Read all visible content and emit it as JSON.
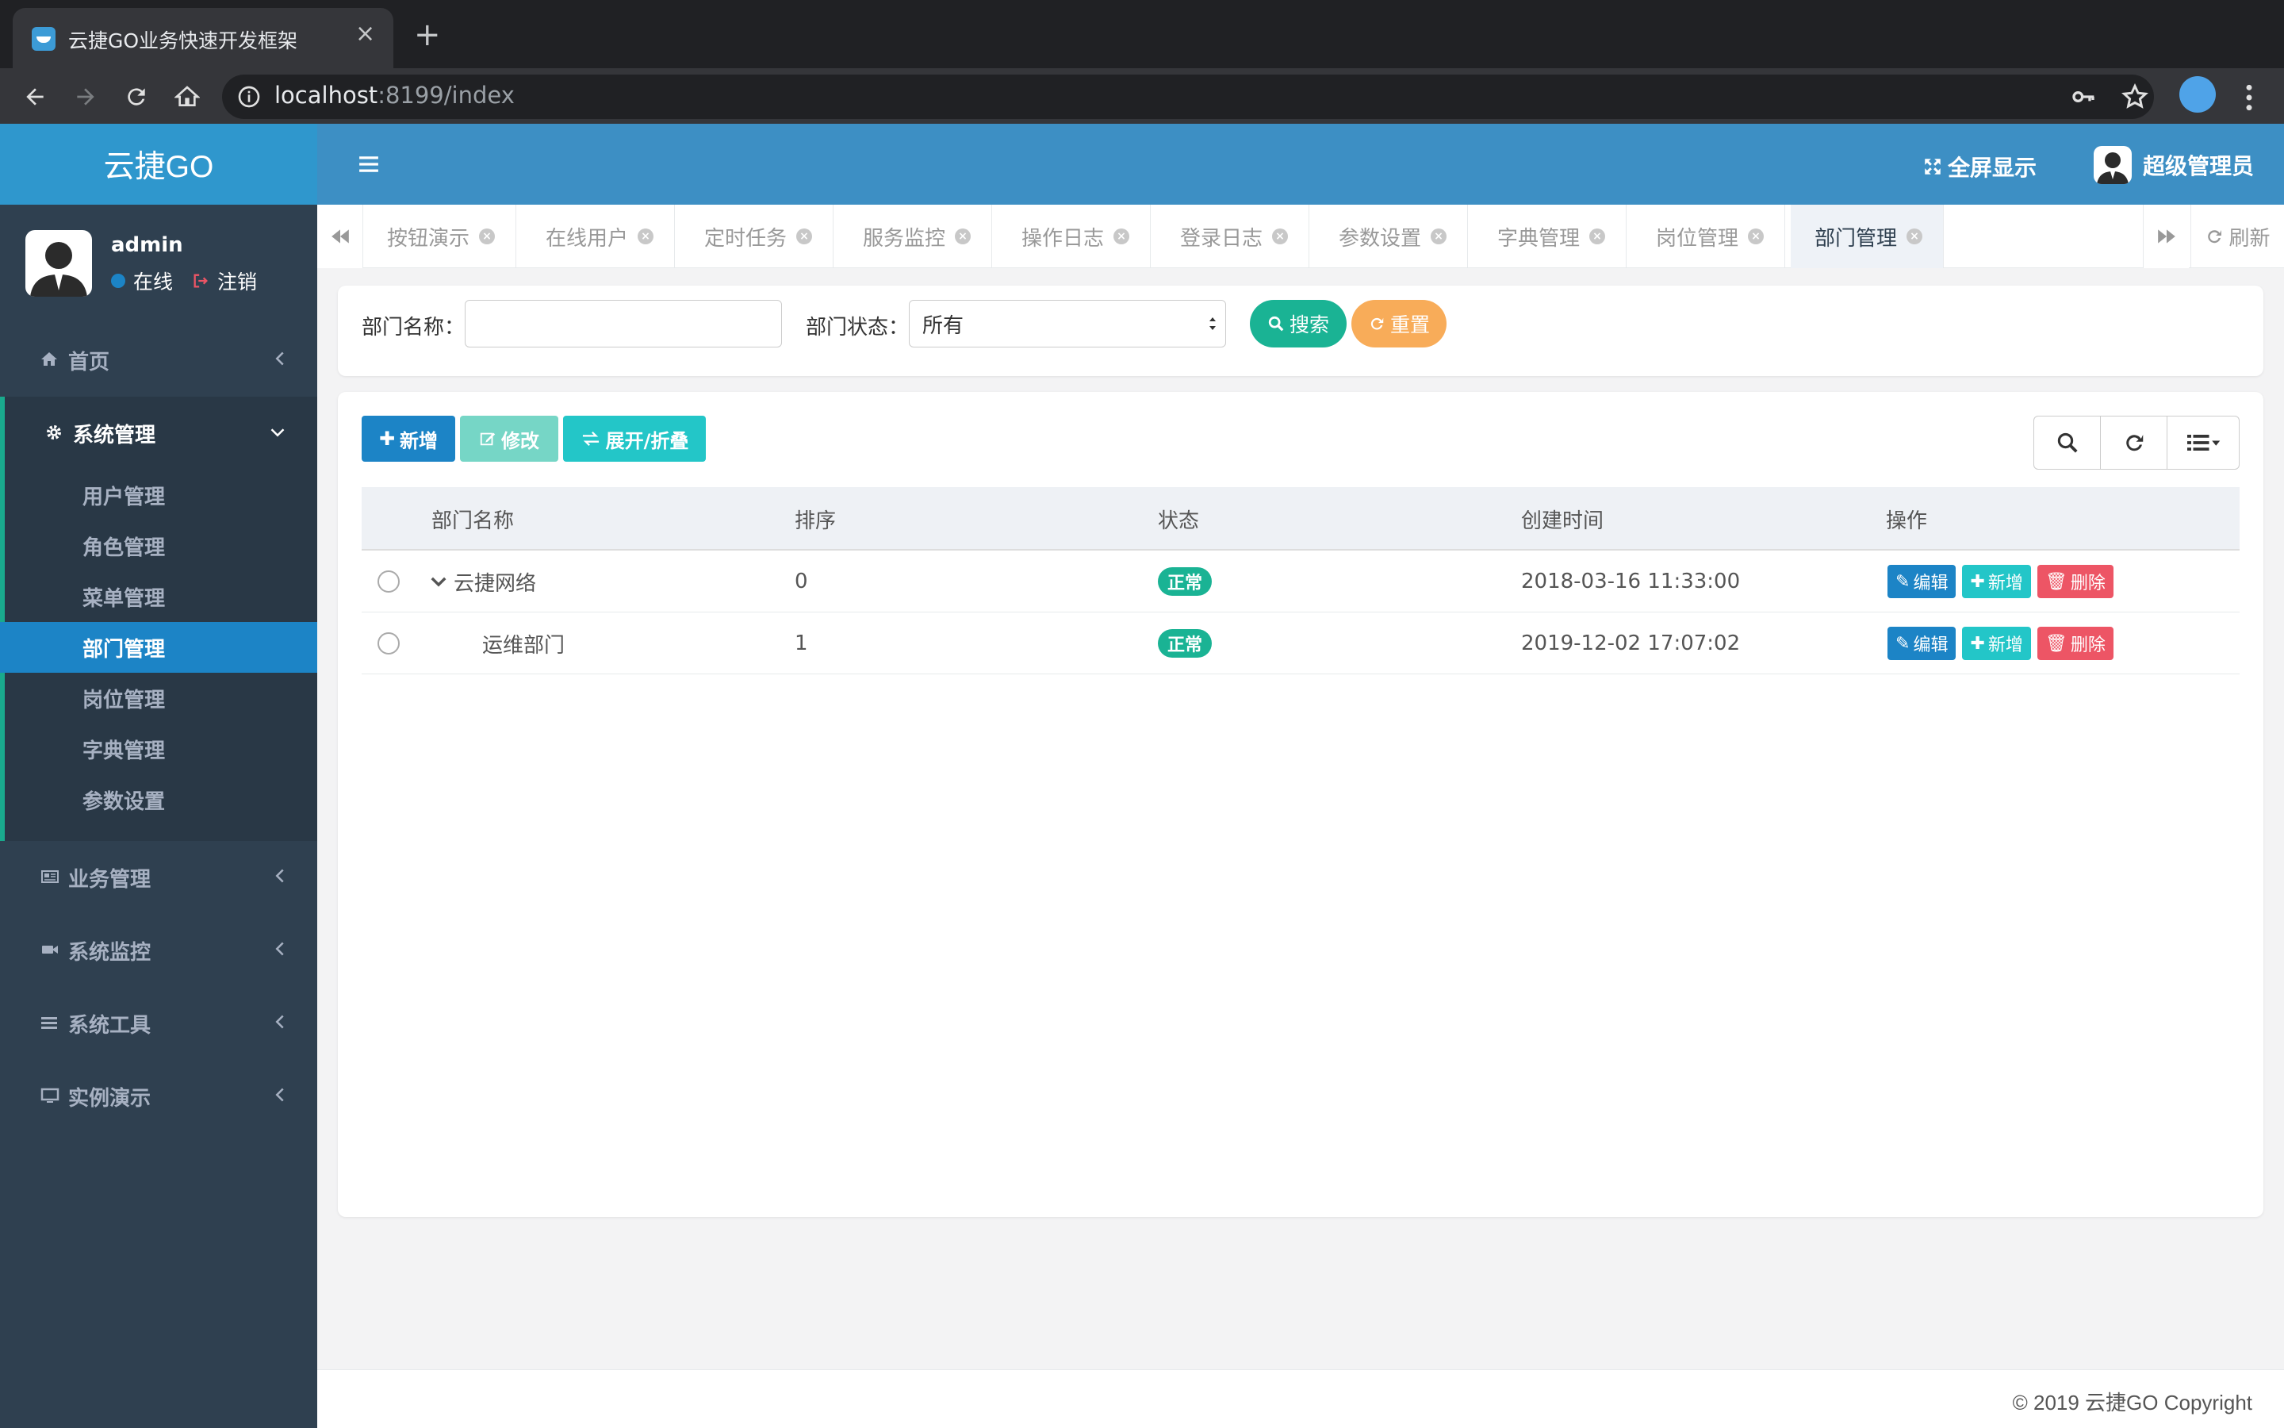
{
  "browser": {
    "tab_title": "云捷GO业务快速开发框架",
    "url_host": "localhost",
    "url_rest": ":8199/index"
  },
  "app": {
    "logo": "云捷GO",
    "fullscreen_label": "全屏显示",
    "user_label": "超级管理员"
  },
  "profile": {
    "name": "admin",
    "status": "在线",
    "logout": "注销"
  },
  "sidebar": {
    "home": "首页",
    "system": "系统管理",
    "sub_items": [
      "用户管理",
      "角色管理",
      "菜单管理",
      "部门管理",
      "岗位管理",
      "字典管理",
      "参数设置"
    ],
    "business": "业务管理",
    "monitor": "系统监控",
    "tools": "系统工具",
    "demo": "实例演示"
  },
  "tabs": [
    "按钮演示",
    "在线用户",
    "定时任务",
    "服务监控",
    "操作日志",
    "登录日志",
    "参数设置",
    "字典管理",
    "岗位管理",
    "部门管理"
  ],
  "refresh_label": "刷新",
  "search": {
    "name_label": "部门名称：",
    "status_label": "部门状态：",
    "status_value": "所有",
    "search_btn": "搜索",
    "reset_btn": "重置"
  },
  "toolbar": {
    "add": "新增",
    "edit": "修改",
    "toggle": "展开/折叠"
  },
  "table": {
    "headers": [
      "部门名称",
      "排序",
      "状态",
      "创建时间",
      "操作"
    ],
    "rows": [
      {
        "name": "云捷网络",
        "order": "0",
        "status": "正常",
        "created": "2018-03-16 11:33:00"
      },
      {
        "name": "运维部门",
        "order": "1",
        "status": "正常",
        "created": "2019-12-02 17:07:02"
      }
    ],
    "op_edit": "编辑",
    "op_add": "新增",
    "op_delete": "删除"
  },
  "footer": {
    "copyright": "© 2019 云捷GO Copyright"
  },
  "colors": {
    "sidebar_bg": "#2f4050",
    "topbar": "#3d8fc4",
    "primary": "#1c84c6",
    "success": "#1ab394",
    "warning": "#f8ac59",
    "danger": "#ed5565",
    "info": "#23c6c8"
  }
}
